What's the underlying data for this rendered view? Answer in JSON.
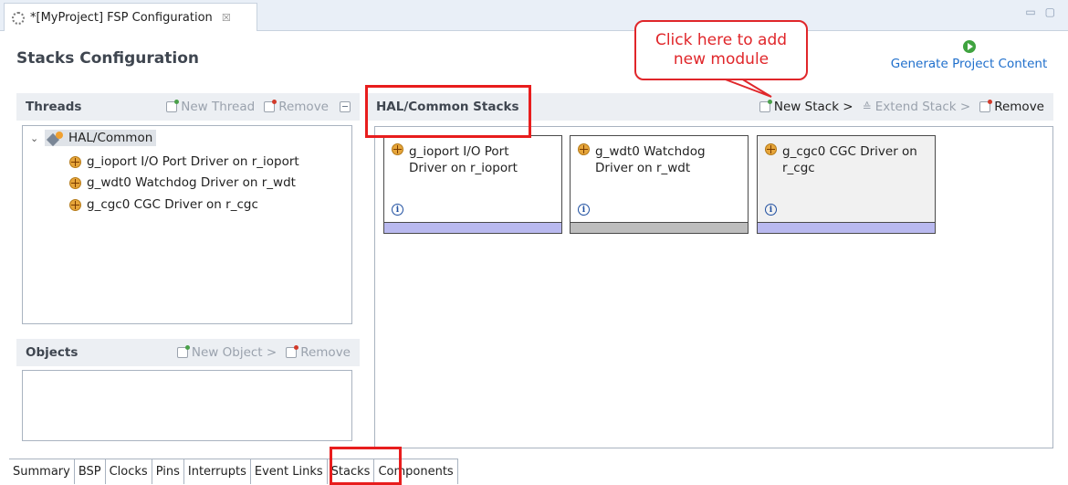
{
  "editor_tab": {
    "title": "*[MyProject] FSP Configuration",
    "close": "☒"
  },
  "window_controls": {
    "minimize": "▭",
    "maximize": "▢"
  },
  "header": {
    "title": "Stacks Configuration",
    "generate_label": "Generate Project Content"
  },
  "threads": {
    "title": "Threads",
    "new_thread": "New Thread",
    "remove": "Remove",
    "tree": {
      "root": "HAL/Common",
      "items": [
        "g_ioport I/O Port Driver on r_ioport",
        "g_wdt0 Watchdog Driver on r_wdt",
        "g_cgc0 CGC Driver on r_cgc"
      ]
    }
  },
  "objects": {
    "title": "Objects",
    "new_object": "New Object >",
    "remove": "Remove"
  },
  "stacks": {
    "title": "HAL/Common Stacks",
    "new_stack": "New Stack >",
    "extend_stack": "Extend Stack >",
    "remove": "Remove",
    "cards": [
      {
        "line1": "g_ioport I/O Port",
        "line2": "Driver on r_ioport",
        "bar_color": "#b9b9ef",
        "bg": "#ffffff"
      },
      {
        "line1": "g_wdt0 Watchdog",
        "line2": "Driver on r_wdt",
        "bar_color": "#bdbdbd",
        "bg": "#ffffff"
      },
      {
        "line1": "g_cgc0 CGC Driver on",
        "line2": "r_cgc",
        "bar_color": "#b9b9ef",
        "bg": "#f1f1f1"
      }
    ]
  },
  "bottom_tabs": [
    "Summary",
    "BSP",
    "Clocks",
    "Pins",
    "Interrupts",
    "Event Links",
    "Stacks",
    "Components"
  ],
  "callout": {
    "line1": "Click here to add",
    "line2": "new module"
  },
  "colors": {
    "accent_red": "#e81d1d",
    "link_blue": "#1f6fcc",
    "header_bg": "#eceff3"
  }
}
